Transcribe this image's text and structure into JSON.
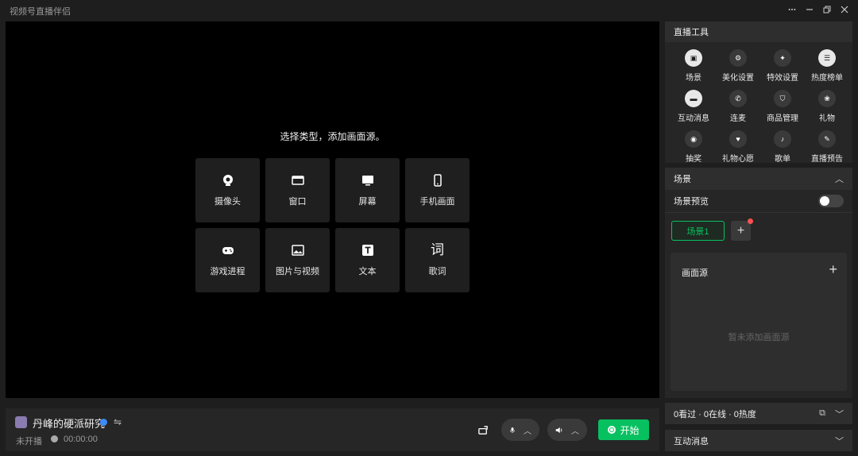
{
  "app": {
    "title": "视频号直播伴侣"
  },
  "preview": {
    "prompt": "选择类型，添加画面源。",
    "sources": [
      {
        "label": "摄像头",
        "icon": "camera-icon"
      },
      {
        "label": "窗口",
        "icon": "window-icon"
      },
      {
        "label": "屏幕",
        "icon": "screen-icon"
      },
      {
        "label": "手机画面",
        "icon": "phone-icon"
      },
      {
        "label": "游戏进程",
        "icon": "gamepad-icon"
      },
      {
        "label": "图片与视频",
        "icon": "image-icon"
      },
      {
        "label": "文本",
        "icon": "text-icon"
      },
      {
        "label": "歌词",
        "icon": "lyrics-icon",
        "glyph": "词"
      }
    ]
  },
  "account": {
    "name": "丹峰的硬派研究",
    "status": "未开播",
    "timer": "00:00:00"
  },
  "controls": {
    "start_label": "开始",
    "accent": "#07c160"
  },
  "tools": {
    "title": "直播工具",
    "items": [
      {
        "label": "场景",
        "icon": "scene-icon"
      },
      {
        "label": "美化设置",
        "icon": "beauty-icon"
      },
      {
        "label": "特效设置",
        "icon": "sparkle-icon"
      },
      {
        "label": "热度榜单",
        "icon": "list-icon"
      },
      {
        "label": "互动消息",
        "icon": "message-icon"
      },
      {
        "label": "连麦",
        "icon": "call-icon"
      },
      {
        "label": "商品管理",
        "icon": "bag-icon"
      },
      {
        "label": "礼物",
        "icon": "gift-icon"
      },
      {
        "label": "抽奖",
        "icon": "lottery-icon"
      },
      {
        "label": "礼物心愿",
        "icon": "heart-icon"
      },
      {
        "label": "歌单",
        "icon": "music-icon"
      },
      {
        "label": "直播预告",
        "icon": "notice-icon"
      }
    ]
  },
  "scene": {
    "title": "场景",
    "preview_label": "场景预览",
    "tab_label": "场景1",
    "source_title": "画面源",
    "empty_text": "暂未添加画面源"
  },
  "stats": {
    "text": "0看过 · 0在线 · 0热度"
  },
  "messages": {
    "title": "互动消息"
  }
}
